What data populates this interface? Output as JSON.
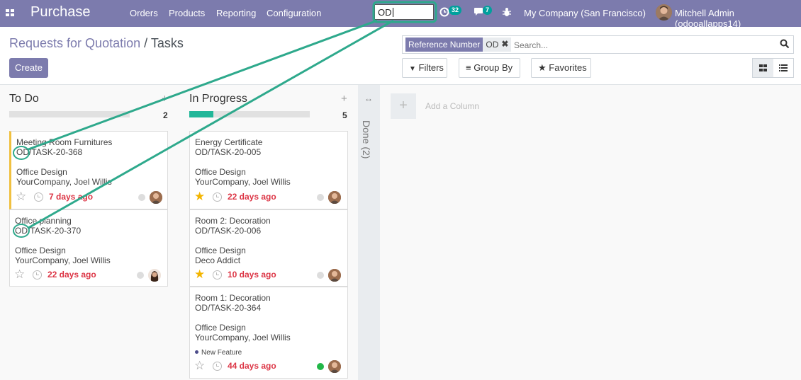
{
  "navbar": {
    "brand": "Purchase",
    "menu": [
      "Orders",
      "Products",
      "Reporting",
      "Configuration"
    ],
    "search_value": "OD",
    "activity_count": "32",
    "messages_count": "7",
    "company": "My Company (San Francisco)",
    "user": "Mitchell Admin (odooallapps14)"
  },
  "breadcrumb": {
    "parent": "Requests for Quotation",
    "separator": "/",
    "current": "Tasks"
  },
  "actions": {
    "create": "Create"
  },
  "search": {
    "facet_label": "Reference Number",
    "facet_value": "OD",
    "placeholder": "Search..."
  },
  "filters": {
    "filters": "Filters",
    "group_by": "Group By",
    "favorites": "Favorites"
  },
  "columns": [
    {
      "title": "To Do",
      "count": "2",
      "progress": 0,
      "cards": [
        {
          "title": "Meeting Room Furnitures",
          "ref": "OD/TASK-20-368",
          "project": "Office Design",
          "partner": "YourCompany, Joel Willis",
          "tag": "",
          "starred": false,
          "deadline": "7 days ago",
          "kanban_state": "normal"
        },
        {
          "title": "Office planning",
          "ref": "OD/TASK-20-370",
          "project": "Office Design",
          "partner": "YourCompany, Joel Willis",
          "tag": "",
          "starred": false,
          "deadline": "22 days ago",
          "kanban_state": "normal"
        }
      ]
    },
    {
      "title": "In Progress",
      "count": "5",
      "progress": 0.2,
      "cards": [
        {
          "title": "Energy Certificate",
          "ref": "OD/TASK-20-005",
          "project": "Office Design",
          "partner": "YourCompany, Joel Willis",
          "tag": "",
          "starred": true,
          "deadline": "22 days ago",
          "kanban_state": "normal"
        },
        {
          "title": "Room 2: Decoration",
          "ref": "OD/TASK-20-006",
          "project": "Office Design",
          "partner": "Deco Addict",
          "tag": "",
          "starred": true,
          "deadline": "10 days ago",
          "kanban_state": "normal"
        },
        {
          "title": "Room 1: Decoration",
          "ref": "OD/TASK-20-364",
          "project": "Office Design",
          "partner": "YourCompany, Joel Willis",
          "tag": "New Feature",
          "starred": false,
          "deadline": "44 days ago",
          "kanban_state": "done"
        }
      ]
    }
  ],
  "folded_column": {
    "label": "Done (2)"
  },
  "add_column": {
    "label": "Add a Column"
  },
  "colors": {
    "brand": "#7c7bad",
    "annotation": "#2ea98c",
    "overdue": "#dc3545",
    "star": "#f3b500"
  }
}
